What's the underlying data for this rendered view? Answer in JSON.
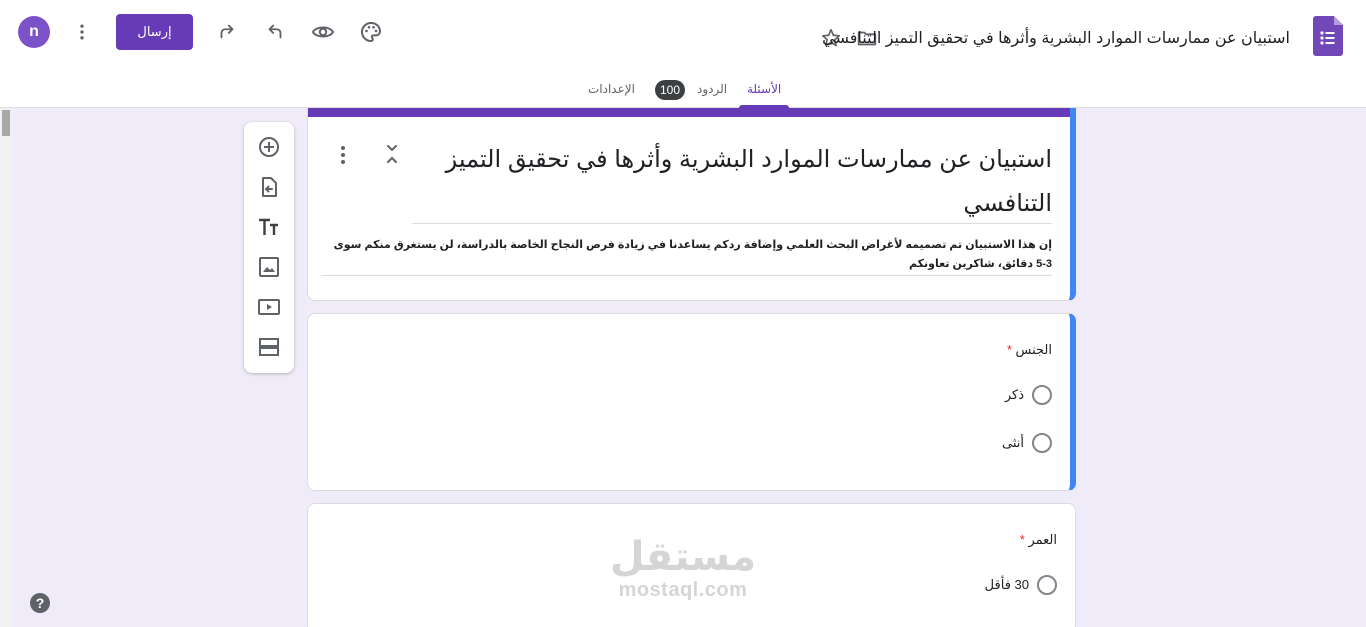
{
  "user": {
    "avatar_letter": "n"
  },
  "header": {
    "send_label": "إرسال",
    "doc_title": "استبيان عن ممارسات الموارد البشرية وأثرها في تحقيق التميز التنافسي"
  },
  "tabs": {
    "questions": "الأسئلة",
    "responses": "الردود",
    "response_count": "100",
    "settings": "الإعدادات"
  },
  "form": {
    "title": "استبيان عن ممارسات الموارد البشرية وأثرها في تحقيق التميز التنافسي",
    "description": "إن هذا الاستبيان تم تصميمه لأغراض البحث العلمي وإضافة ردكم يساعدنا في زيادة فرص النجاح الخاصة بالدراسة، لن يستغرق منكم سوى 3-5 دقائق، شاكرين تعاونكم"
  },
  "questions": [
    {
      "label": "الجنس",
      "required_mark": "*",
      "options": [
        "ذكر",
        "أنثى"
      ]
    },
    {
      "label": "العمر",
      "required_mark": "*",
      "options": [
        "30 فأقل"
      ]
    }
  ],
  "watermark": {
    "arabic": "مستقل",
    "latin": "mostaql.com"
  },
  "help": {
    "label": "?"
  },
  "colors": {
    "accent": "#673ab7",
    "active_border": "#4285f4",
    "background": "#f0ebf8"
  }
}
